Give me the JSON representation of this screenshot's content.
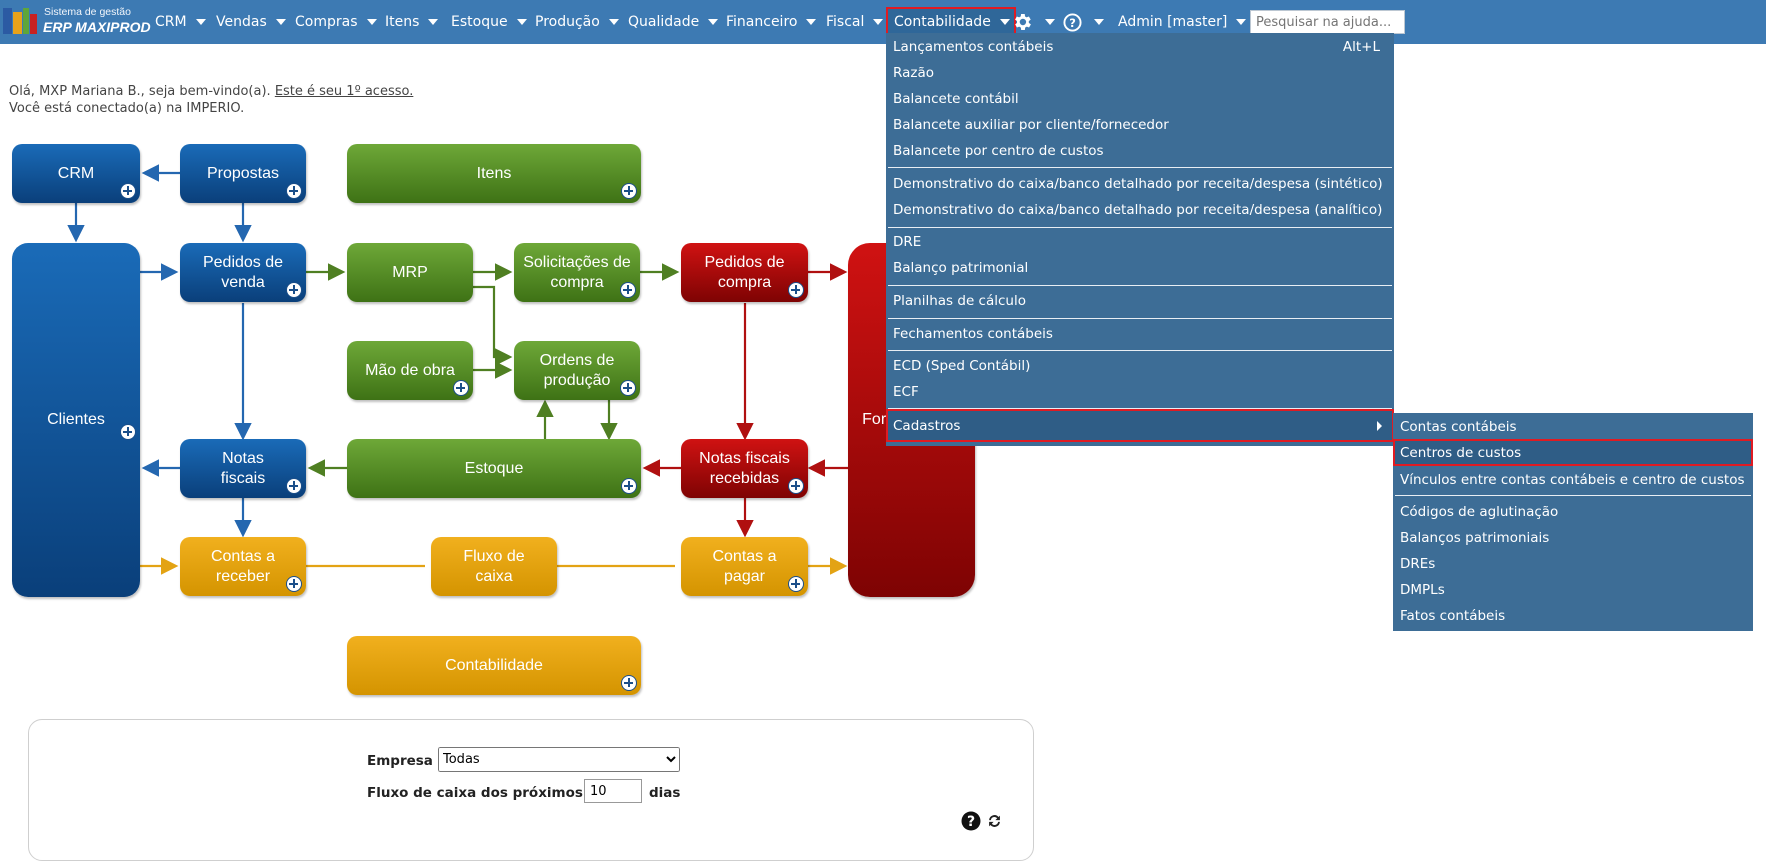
{
  "brand": {
    "line1": "Sistema de gestão",
    "line2": "ERP MAXIPROD"
  },
  "nav": {
    "items": [
      "CRM",
      "Vendas",
      "Compras",
      "Itens",
      "Estoque",
      "Produção",
      "Qualidade",
      "Financeiro",
      "Fiscal",
      "Contabilidade"
    ],
    "admin": "Admin [master]",
    "search_placeholder": "Pesquisar na ajuda..."
  },
  "greeting": {
    "line1_prefix": "Olá, MXP Mariana B., seja bem-vindo(a).",
    "line1_link": "Este é seu 1º acesso.",
    "line2": "Você está conectado(a) na IMPERIO."
  },
  "flow": {
    "crm": "CRM",
    "propostas": "Propostas",
    "itens": "Itens",
    "clientes": "Clientes",
    "pedidos_venda": "Pedidos de\nvenda",
    "mrp": "MRP",
    "solicitacoes": "Solicitações de\ncompra",
    "pedidos_compra": "Pedidos de\ncompra",
    "mao_obra": "Mão de obra",
    "ordens": "Ordens de\nprodução",
    "notas_fiscais": "Notas\nfiscais",
    "estoque": "Estoque",
    "notas_recebidas": "Notas fiscais\nrecebidas",
    "fornecedores": "Fornecedores",
    "contas_receber": "Contas a\nreceber",
    "fluxo_caixa": "Fluxo de\ncaixa",
    "contas_pagar": "Contas a\npagar",
    "contabilidade": "Contabilidade"
  },
  "menu": {
    "items": [
      "Lançamentos contábeis",
      "Razão",
      "Balancete contábil",
      "Balancete auxiliar por cliente/fornecedor",
      "Balancete por centro de custos",
      "Demonstrativo do caixa/banco detalhado por receita/despesa (sintético)",
      "Demonstrativo do caixa/banco detalhado por receita/despesa (analítico)",
      "DRE",
      "Balanço patrimonial",
      "Planilhas de cálculo",
      "Fechamentos contábeis",
      "ECD (Sped Contábil)",
      "ECF",
      "Cadastros"
    ],
    "shortcut": "Alt+L"
  },
  "submenu": {
    "items": [
      "Contas contábeis",
      "Centros de custos",
      "Vínculos entre contas contábeis e centro de custos",
      "Códigos de aglutinação",
      "Balanços patrimoniais",
      "DREs",
      "DMPLs",
      "Fatos contábeis"
    ]
  },
  "filters": {
    "empresa_label": "Empresa",
    "empresa_value": "Todas",
    "fluxo_label": "Fluxo de caixa dos próximos",
    "fluxo_value": "10",
    "fluxo_suffix": "dias"
  },
  "colors": {
    "topbar": "#3d7ab3",
    "menu": "#3d6d96",
    "highlight": "#e01b22"
  },
  "icons": [
    "gear-icon",
    "help-icon",
    "question-icon",
    "refresh-icon",
    "plus-icon"
  ]
}
